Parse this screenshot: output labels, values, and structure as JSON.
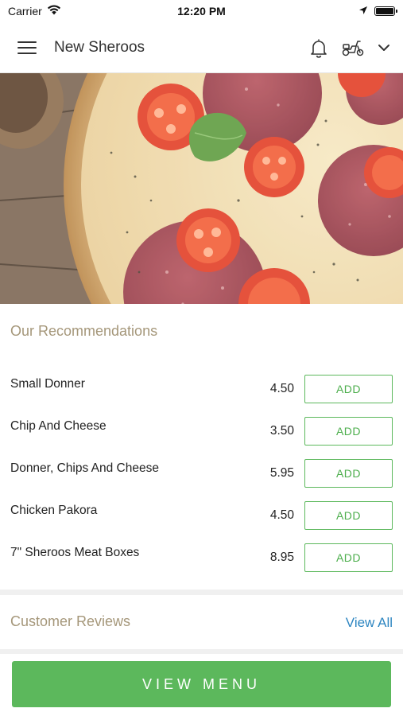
{
  "status_bar": {
    "carrier": "Carrier",
    "time": "12:20 PM"
  },
  "header": {
    "title": "New Sheroos",
    "menu_icon": "hamburger-menu-icon",
    "notification_icon": "bell-icon",
    "delivery_icon": "scooter-icon",
    "dropdown_icon": "chevron-down-icon"
  },
  "hero": {
    "image": "pizza-with-salami-and-tomatoes"
  },
  "recommendations": {
    "title": "Our Recommendations",
    "items": [
      {
        "name": "Small Donner",
        "price": "4.50",
        "action": "ADD"
      },
      {
        "name": "Chip And Cheese",
        "price": "3.50",
        "action": "ADD"
      },
      {
        "name": "Donner, Chips And Cheese",
        "price": "5.95",
        "action": "ADD"
      },
      {
        "name": "Chicken Pakora",
        "price": "4.50",
        "action": "ADD"
      },
      {
        "name": "7\" Sheroos Meat Boxes",
        "price": "8.95",
        "action": "ADD"
      }
    ]
  },
  "reviews": {
    "title": "Customer Reviews",
    "view_all": "View All"
  },
  "footer": {
    "view_menu": "VIEW MENU"
  },
  "colors": {
    "accent_green": "#5cb85c",
    "section_title": "#a5977a",
    "link_blue": "#2e86c1"
  }
}
